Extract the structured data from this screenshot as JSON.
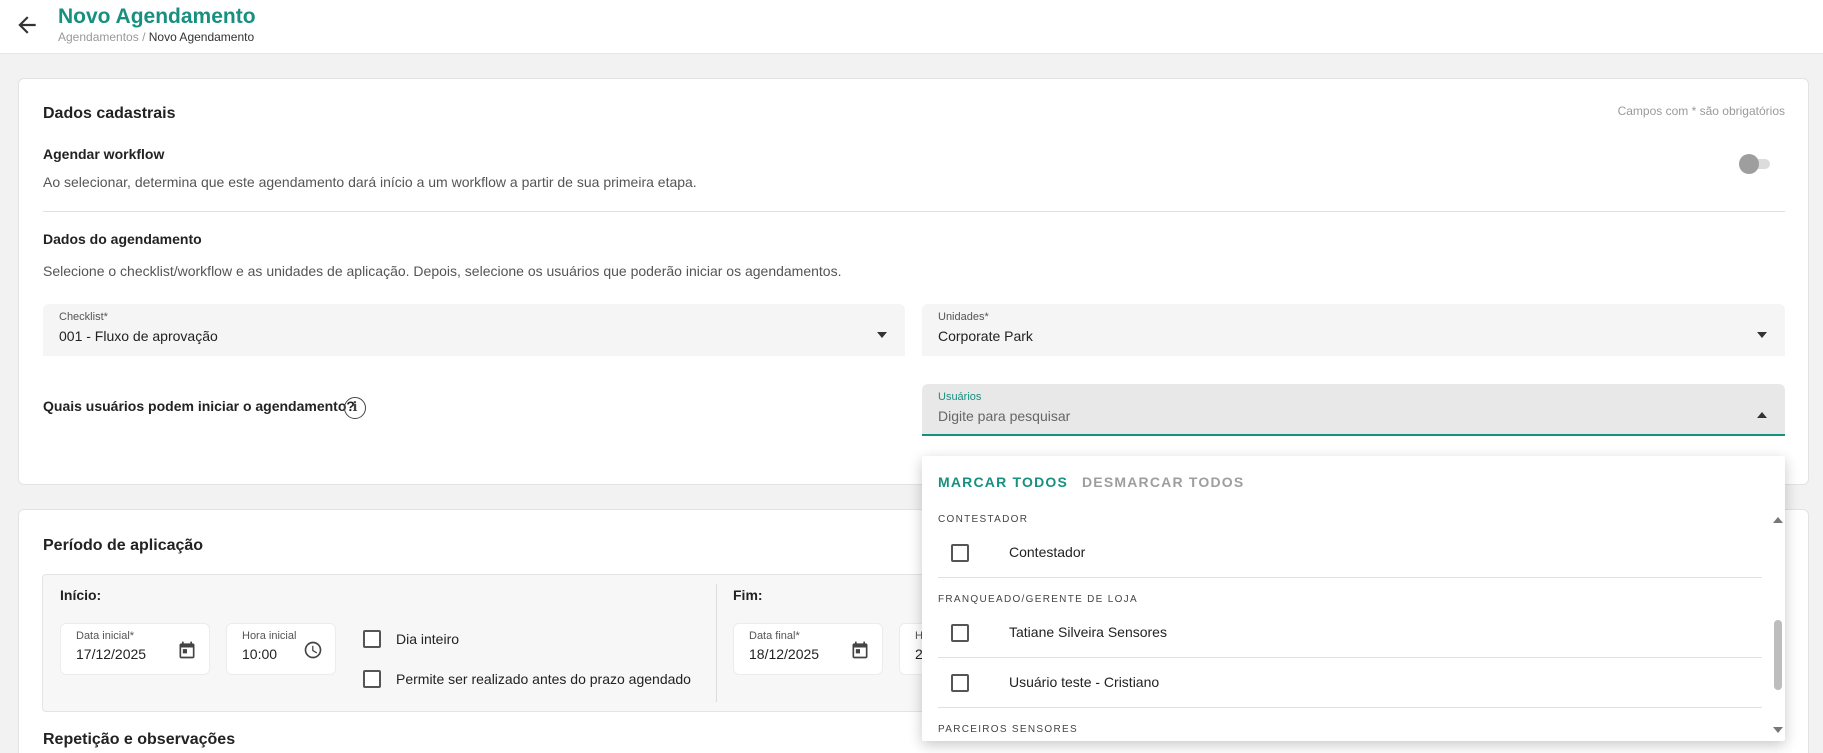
{
  "header": {
    "title": "Novo Agendamento",
    "breadcrumb_parent": "Agendamentos",
    "breadcrumb_sep": " / ",
    "breadcrumb_current": "Novo Agendamento",
    "accent_color": "#17907f"
  },
  "registration": {
    "title": "Dados cadastrais",
    "required_hint": "Campos com * são obrigatórios",
    "workflow_title": "Agendar workflow",
    "workflow_desc": "Ao selecionar, determina que este agendamento dará início a um workflow a partir de sua primeira etapa.",
    "workflow_toggle_on": false,
    "schedule_title": "Dados do agendamento",
    "schedule_desc": "Selecione o checklist/workflow e as unidades de aplicação. Depois, selecione os usuários que poderão iniciar os agendamentos.",
    "checklist_label": "Checklist*",
    "checklist_value": "001 - Fluxo de aprovação",
    "units_label": "Unidades*",
    "units_value": "Corporate Park",
    "users_question": "Quais usuários podem iniciar o agendamento?",
    "info_icon": "i",
    "users_label": "Usuários",
    "users_placeholder": "Digite para pesquisar"
  },
  "period": {
    "title": "Período de aplicação",
    "start_label": "Início:",
    "end_label": "Fim:",
    "start_date_label": "Data inicial*",
    "start_date_value": "17/12/2025",
    "start_time_label": "Hora inicial",
    "start_time_value": "10:00",
    "all_day_label": "Dia inteiro",
    "allow_before_label": "Permite ser realizado antes do prazo agendado",
    "end_date_label": "Data final*",
    "end_date_value": "18/12/2025",
    "end_time_label_partial": "H",
    "end_time_value_partial": "2"
  },
  "repetition": {
    "title": "Repetição e observações"
  },
  "users_dropdown": {
    "mark_all": "MARCAR TODOS",
    "unmark_all": "DESMARCAR TODOS",
    "groups": [
      {
        "name": "CONTESTADOR",
        "items": [
          "Contestador"
        ]
      },
      {
        "name": "FRANQUEADO/GERENTE DE LOJA",
        "items": [
          "Tatiane Silveira Sensores",
          "Usuário teste - Cristiano"
        ]
      },
      {
        "name": "PARCEIROS SENSORES",
        "items": []
      }
    ]
  }
}
